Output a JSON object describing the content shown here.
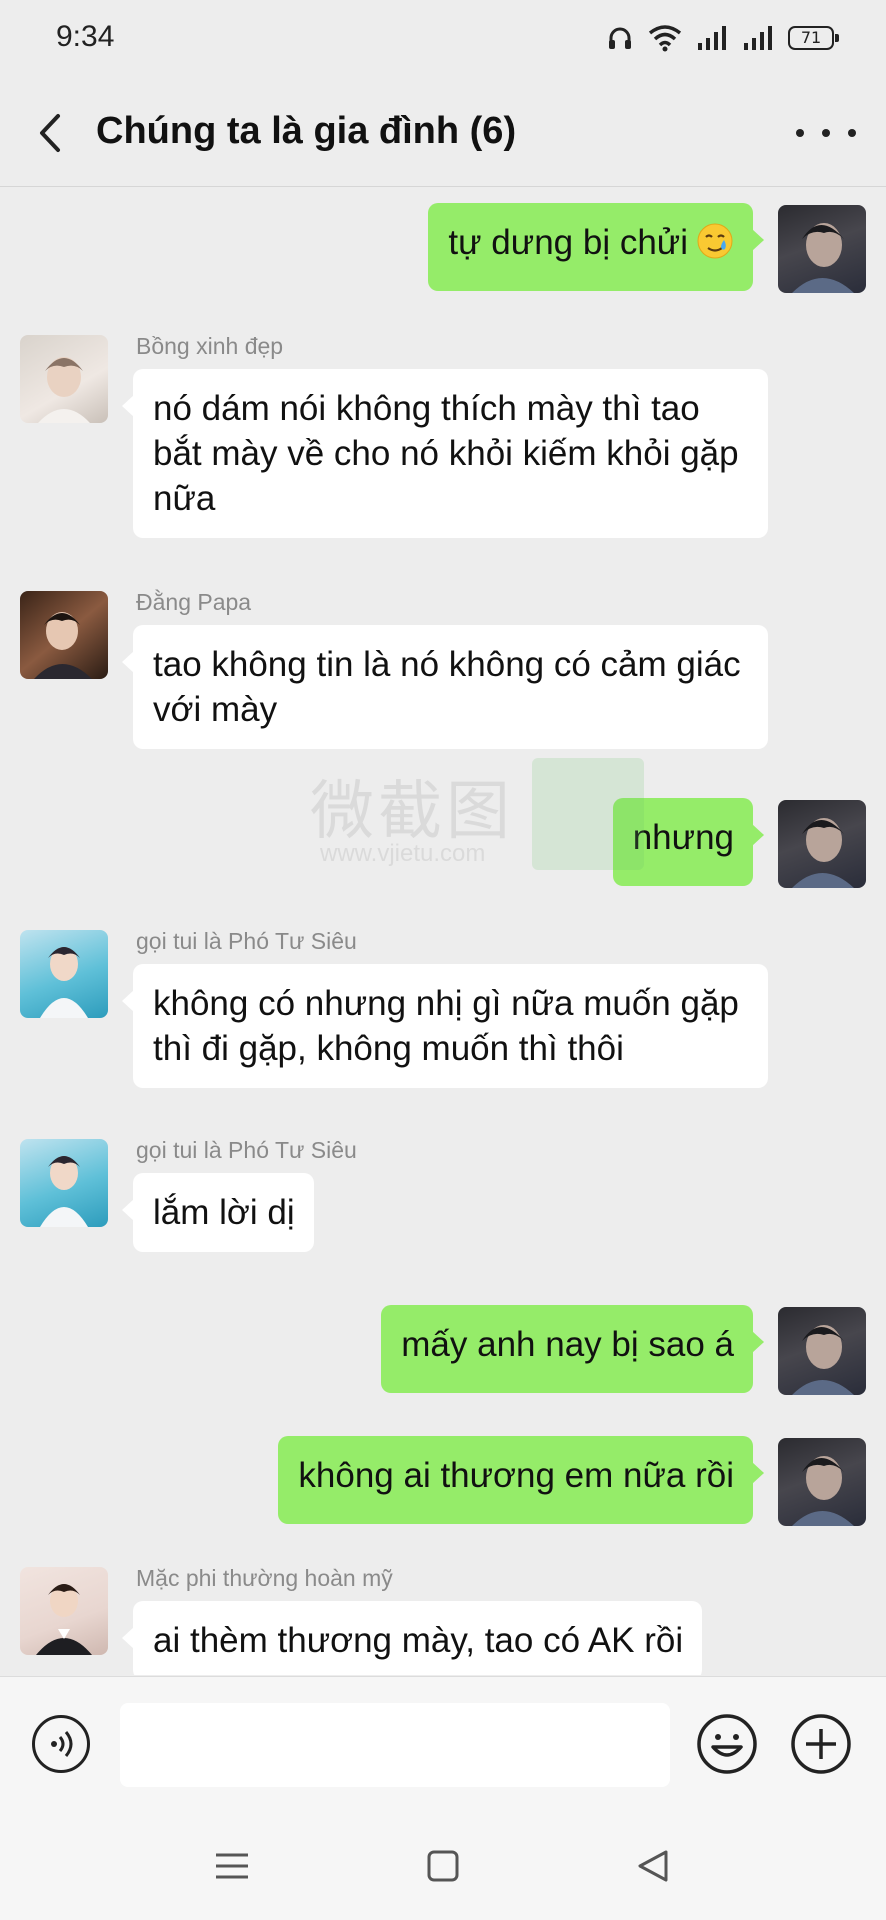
{
  "status_bar": {
    "time": "9:34",
    "battery": "71",
    "icons": [
      "headphones-icon",
      "wifi-icon",
      "signal-icon",
      "signal-icon",
      "battery-icon"
    ]
  },
  "header": {
    "title": "Chúng ta là gia đình (6)",
    "back_icon": "chevron-left-icon",
    "more_icon": "more-dots-icon"
  },
  "watermark": {
    "text": "微截图",
    "url": "www.vjietu.com"
  },
  "messages": [
    {
      "side": "right",
      "sender": "",
      "text": "tự dưng bị chửi",
      "emoji": "tearful-smile-emoji"
    },
    {
      "side": "left",
      "sender": "Bồng xinh đẹp",
      "text": "nó dám nói không thích mày thì tao bắt mày về cho nó khỏi kiếm khỏi gặp nữa"
    },
    {
      "side": "left",
      "sender": "Đằng Papa",
      "text": "tao không tin là nó không có cảm giác với mày"
    },
    {
      "side": "right",
      "sender": "",
      "text": "nhưng"
    },
    {
      "side": "left",
      "sender": "gọi tui là Phó Tư Siêu",
      "text": "không có nhưng nhị gì nữa muốn gặp thì đi gặp, không muốn thì thôi"
    },
    {
      "side": "left",
      "sender": "gọi tui là Phó Tư Siêu",
      "text": "lắm lời dị"
    },
    {
      "side": "right",
      "sender": "",
      "text": "mấy anh nay bị sao á"
    },
    {
      "side": "right",
      "sender": "",
      "text": "không ai thương em nữa rồi"
    },
    {
      "side": "left",
      "sender": "Mặc phi thường hoàn mỹ",
      "text": "ai thèm thương mày, tao có AK rồi"
    }
  ],
  "input_bar": {
    "placeholder": "",
    "voice_icon": "voice-icon",
    "emoji_icon": "emoji-icon",
    "plus_icon": "plus-icon"
  },
  "nav_bar": {
    "icons": [
      "menu-icon",
      "home-square-icon",
      "back-triangle-icon"
    ]
  },
  "colors": {
    "background": "#ededed",
    "self_bubble": "#95ec69",
    "other_bubble": "#ffffff",
    "sender_name": "#8a8a8a"
  }
}
